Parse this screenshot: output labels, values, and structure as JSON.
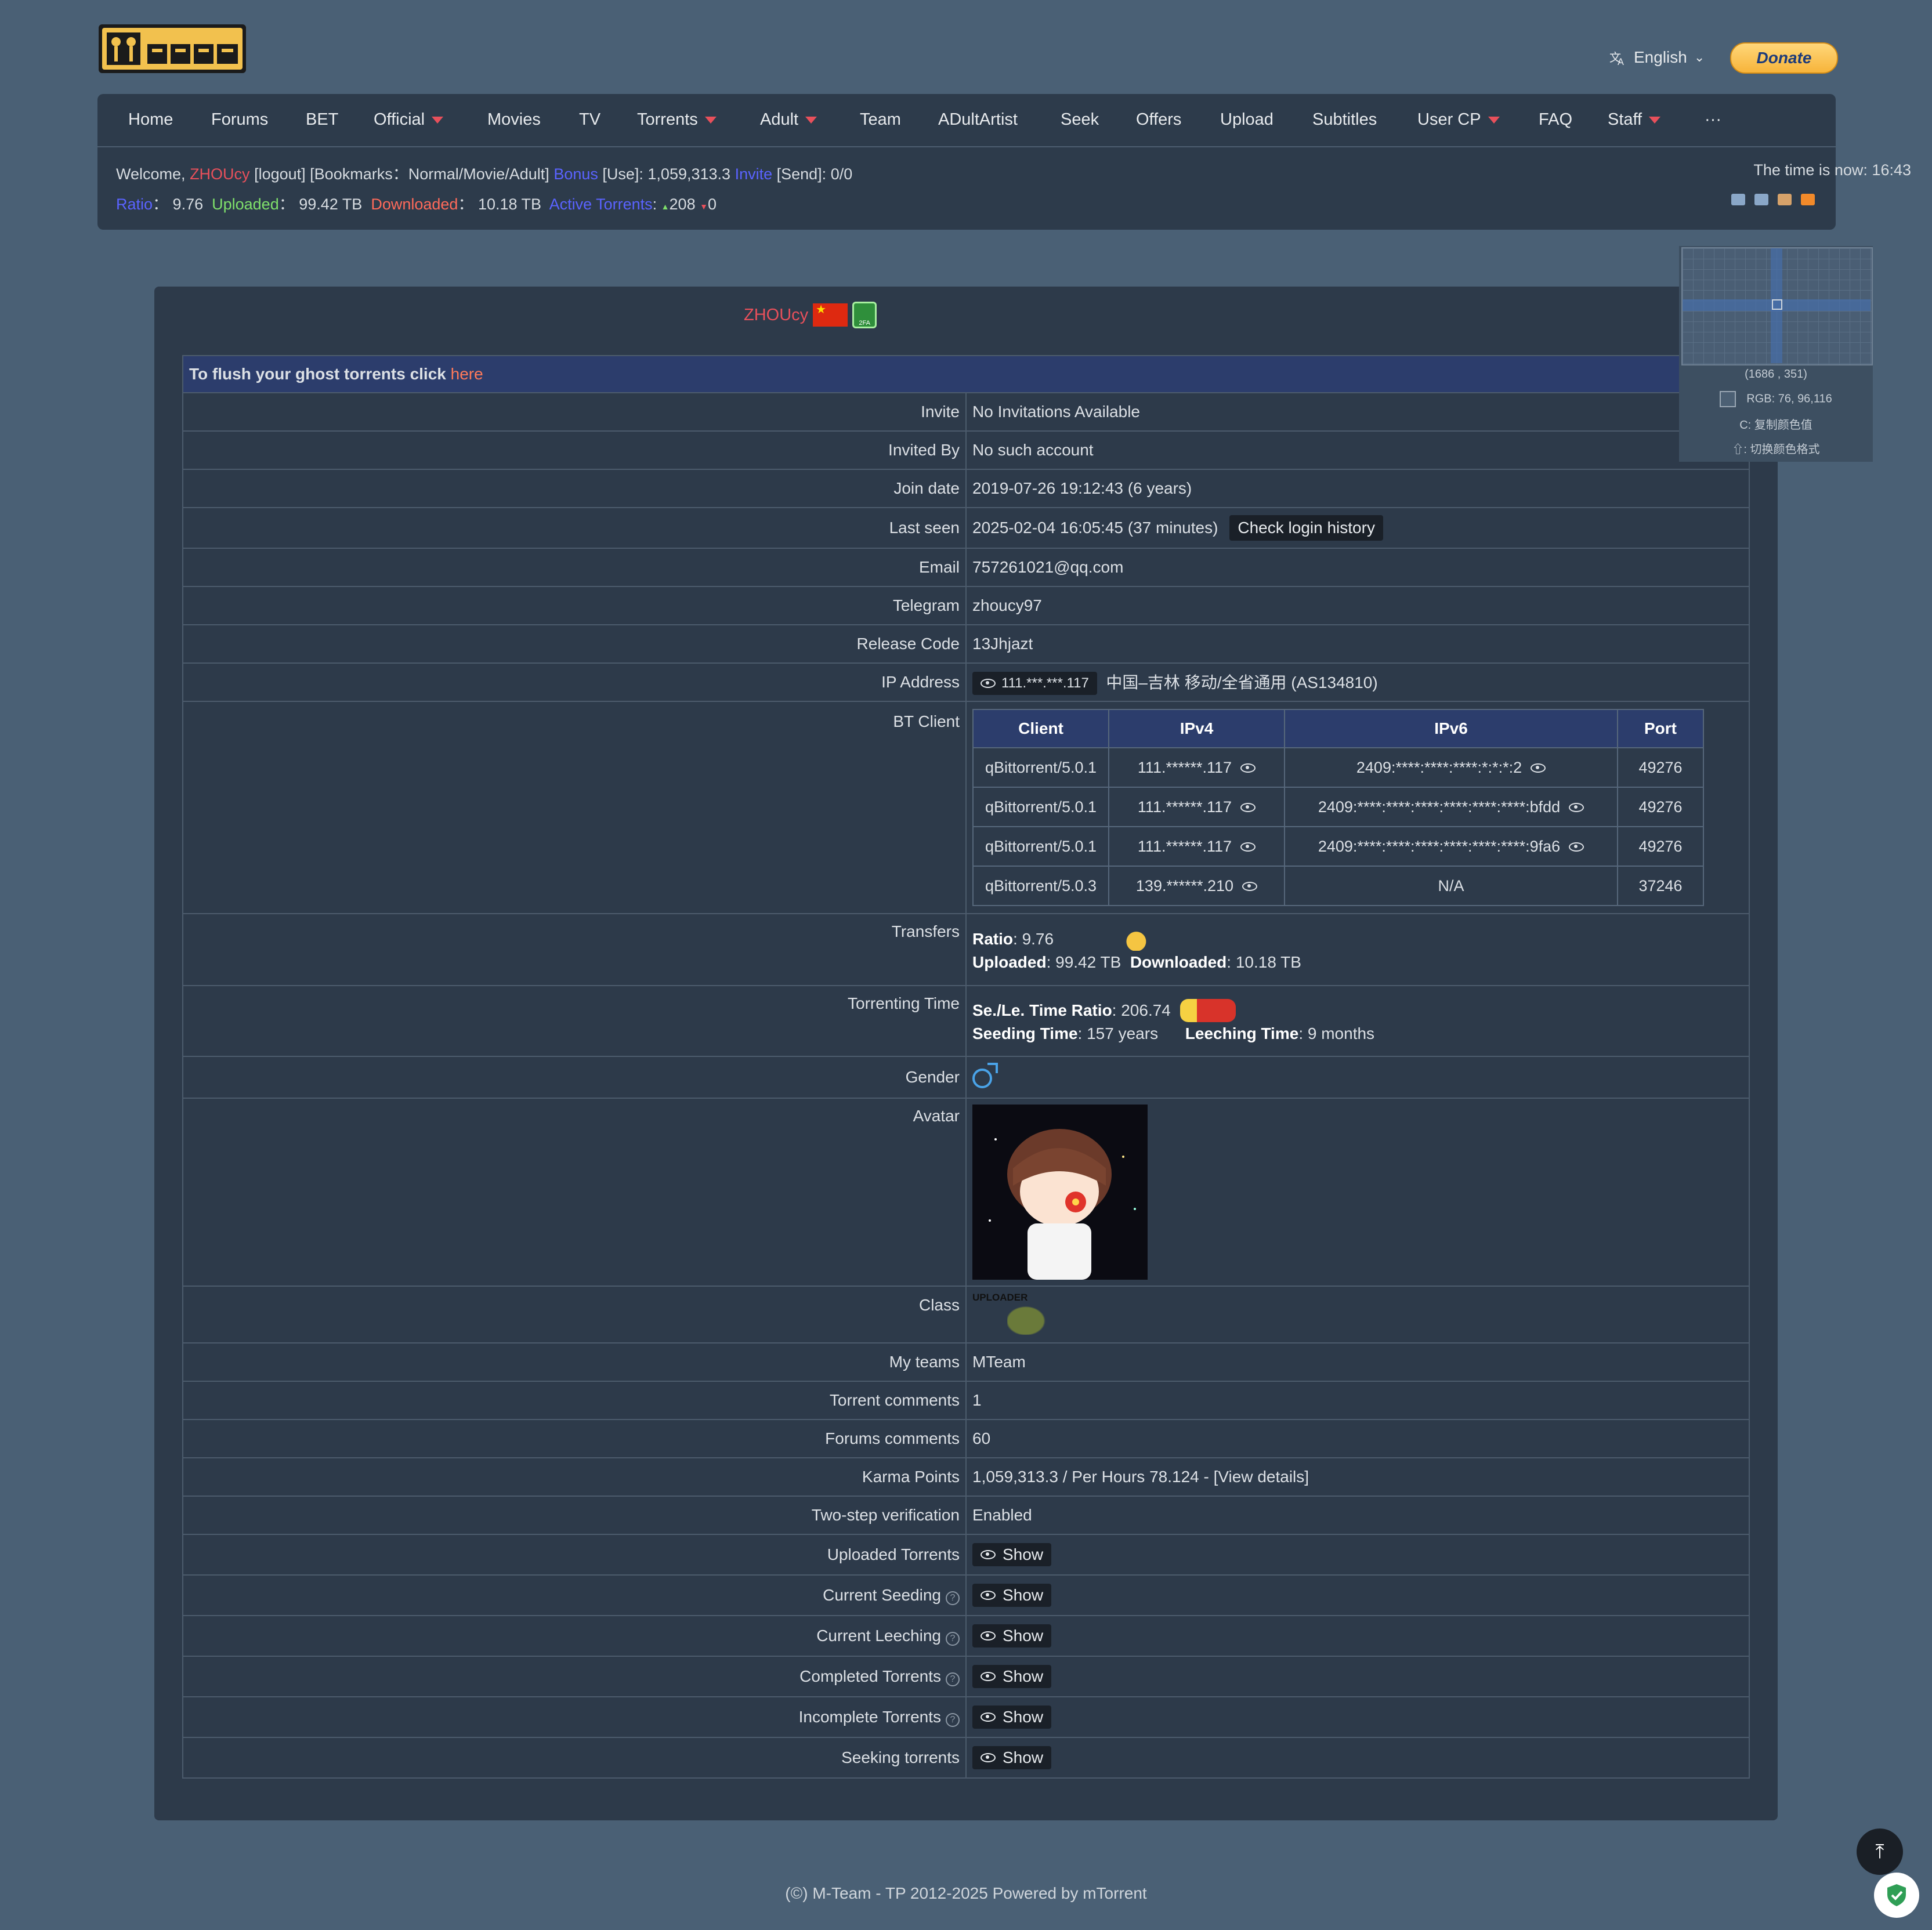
{
  "header": {
    "language": "English",
    "donate": "Donate"
  },
  "nav": {
    "items": [
      "Home",
      "Forums",
      "BET",
      "Official",
      "Movies",
      "TV",
      "Torrents",
      "Adult",
      "Team",
      "ADultArtist",
      "Seek",
      "Offers",
      "Upload",
      "Subtitles",
      "User CP",
      "FAQ",
      "Staff",
      "···"
    ]
  },
  "userbar": {
    "welcome": "Welcome,",
    "username": "ZHOUcy",
    "logout": "[logout]",
    "bookmarks": "[Bookmarks：Normal/Movie/Adult]",
    "bonus": "Bonus",
    "bonus_val": "[Use]: 1,059,313.3",
    "invite": "Invite",
    "invite_val": "[Send]: 0/0",
    "ratio_lbl": "Ratio",
    "ratio": "9.76",
    "uploaded_lbl": "Uploaded",
    "uploaded": "99.42 TB",
    "downloaded_lbl": "Downloaded",
    "downloaded": "10.18 TB",
    "active_lbl": "Active Torrents",
    "active_up": "208",
    "active_down": "0",
    "time": "The time is now: 16:43"
  },
  "profile": {
    "username": "ZHOUcy",
    "flush_text": "To flush your ghost torrents click",
    "flush_link": "here",
    "rows": {
      "invite_lbl": "Invite",
      "invite": "No Invitations Available",
      "invitedby_lbl": "Invited By",
      "invitedby": "No such account",
      "join_lbl": "Join date",
      "join": "2019-07-26 19:12:43 (6 years)",
      "lastseen_lbl": "Last seen",
      "lastseen": "2025-02-04 16:05:45 (37 minutes)",
      "login_history": "Check login history",
      "email_lbl": "Email",
      "email": "757261021@qq.com",
      "telegram_lbl": "Telegram",
      "telegram": "zhoucy97",
      "release_lbl": "Release Code",
      "release": "13Jhjazt",
      "ip_lbl": "IP Address",
      "ip": "111.***.***.117",
      "ip_loc": "中国–吉林 移动/全省通用 (AS134810)",
      "bt_lbl": "BT Client",
      "transfers_lbl": "Transfers",
      "ratio_lbl": "Ratio",
      "ratio": "9.76",
      "up_lbl": "Uploaded",
      "up": "99.42 TB",
      "down_lbl": "Downloaded",
      "down": "10.18 TB",
      "ttime_lbl": "Torrenting Time",
      "selratio_lbl": "Se./Le. Time Ratio",
      "selratio": "206.74",
      "seedtime_lbl": "Seeding Time",
      "seedtime": "157 years",
      "leechtime_lbl": "Leeching Time",
      "leechtime": "9 months",
      "gender_lbl": "Gender",
      "avatar_lbl": "Avatar",
      "class_lbl": "Class",
      "class_text": "UPLOADER",
      "teams_lbl": "My teams",
      "teams": "MTeam",
      "tcomments_lbl": "Torrent comments",
      "tcomments": "1",
      "fcomments_lbl": "Forums comments",
      "fcomments": "60",
      "karma_lbl": "Karma Points",
      "karma": "1,059,313.3 / Per Hours 78.124 - [View details]",
      "twostep_lbl": "Two-step verification",
      "twostep": "Enabled",
      "uploaded_t_lbl": "Uploaded Torrents",
      "cur_seed_lbl": "Current Seeding",
      "cur_leech_lbl": "Current Leeching",
      "completed_lbl": "Completed Torrents",
      "incomplete_lbl": "Incomplete Torrents",
      "seeding_lbl": "Seeking torrents",
      "show": "Show"
    },
    "bt_table": {
      "headers": [
        "Client",
        "IPv4",
        "IPv6",
        "Port"
      ],
      "rows": [
        [
          "qBittorrent/5.0.1",
          "111.******.117",
          "2409:****:****:****:*:*:*:2",
          "49276"
        ],
        [
          "qBittorrent/5.0.1",
          "111.******.117",
          "2409:****:****:****:****:****:****:bfdd",
          "49276"
        ],
        [
          "qBittorrent/5.0.1",
          "111.******.117",
          "2409:****:****:****:****:****:****:9fa6",
          "49276"
        ],
        [
          "qBittorrent/5.0.3",
          "139.******.210",
          "N/A",
          "37246"
        ]
      ]
    }
  },
  "picker": {
    "coords": "(1686 , 351)",
    "rgb": "RGB:  76, 96,116",
    "copy": "C: 复制颜色值",
    "switch": "⇧: 切换颜色格式"
  },
  "footer": "(©) M-Team - TP 2012-2025 Powered by mTorrent",
  "colors": {
    "accent_red": "#e8505b",
    "link_blue": "#5a63ff",
    "green": "#7fe06b",
    "bg": "#4a6075",
    "panel": "#2d3a4a"
  }
}
